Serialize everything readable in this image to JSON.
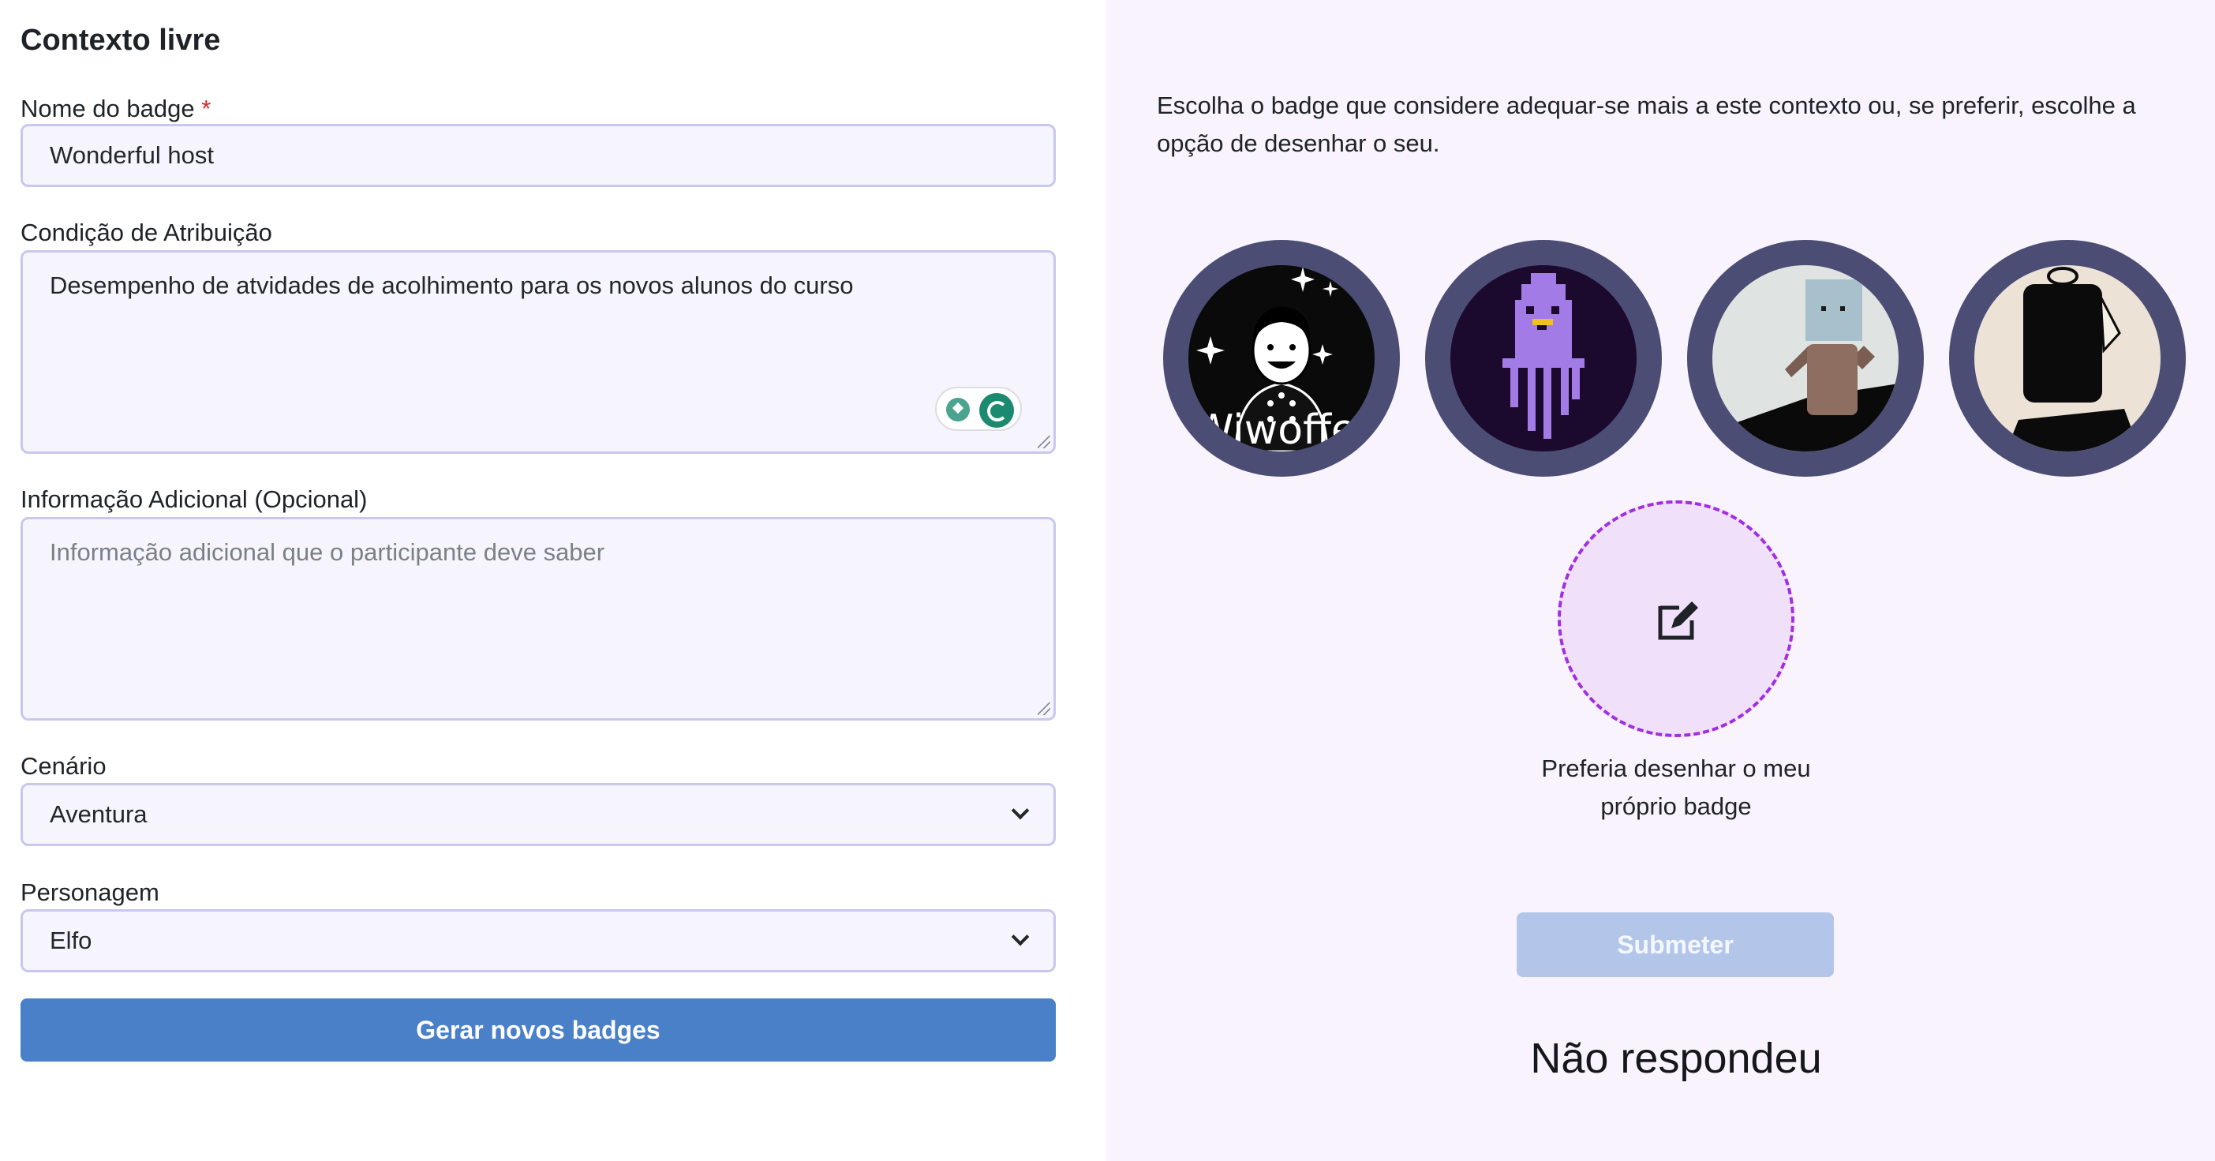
{
  "form": {
    "title": "Contexto livre",
    "badge_name": {
      "label": "Nome do badge",
      "required_mark": "*",
      "value": "Wonderful host"
    },
    "condition": {
      "label": "Condição de Atribuição",
      "value": "Desempenho de atvidades de acolhimento para os novos alunos do curso"
    },
    "additional_info": {
      "label": "Informação Adicional (Opcional)",
      "placeholder": "Informação adicional que o participante deve saber"
    },
    "scenario": {
      "label": "Cenário",
      "selected": "Aventura"
    },
    "character": {
      "label": "Personagem",
      "selected": "Elfo"
    },
    "generate_label": "Gerar novos badges"
  },
  "gallery": {
    "intro": "Escolha o badge que considere adequar-se mais a este contexto ou, se preferir, escolhe a opção de desenhar o seu.",
    "badges": [
      {
        "id": "badge-1",
        "text": "Wiwoffed"
      },
      {
        "id": "badge-2"
      },
      {
        "id": "badge-3"
      },
      {
        "id": "badge-4"
      }
    ],
    "draw_own_label": "Preferia desenhar o meu próprio badge",
    "submit_label": "Submeter",
    "status": "Não respondeu"
  },
  "colors": {
    "primary_button": "#4a80c8",
    "submit_disabled": "#b3c6ea",
    "badge_ring": "#4c4d75",
    "draw_dashed": "#a12ee0",
    "right_panel_bg": "#f8f3fd"
  }
}
